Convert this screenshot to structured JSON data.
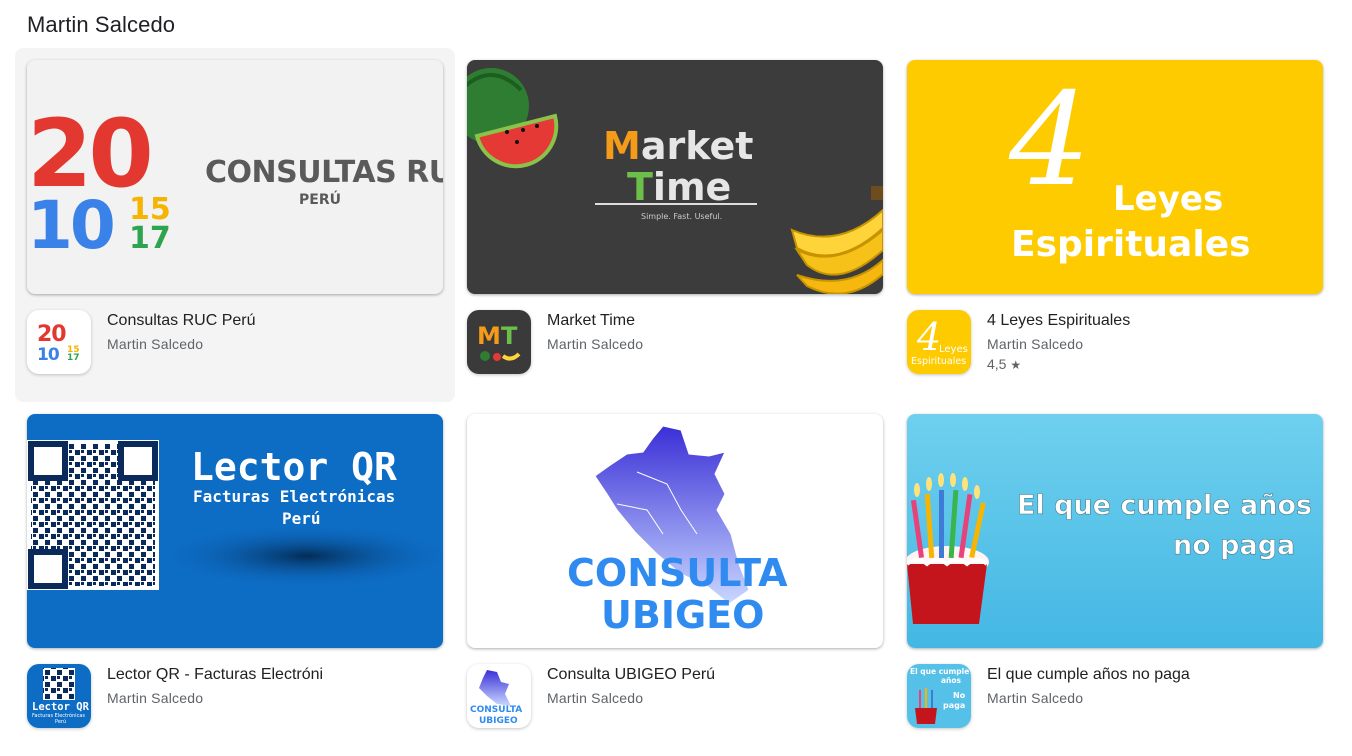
{
  "section": {
    "title": "Martin Salcedo"
  },
  "apps": [
    {
      "name": "Consultas RUC Perú",
      "developer": "Martin Salcedo",
      "banner": {
        "year_top": "20",
        "year_bottom": "10",
        "num_a": "15",
        "num_b": "17",
        "title": "CONSULTAS RUC",
        "subtitle": "PERÚ"
      },
      "icon": {
        "top": "20",
        "bottom": "10",
        "a": "15",
        "b": "17"
      }
    },
    {
      "name": "Market Time",
      "developer": "Martin Salcedo",
      "banner": {
        "line1_first": "M",
        "line1_rest": "arket",
        "line2_first": "T",
        "line2_rest": "ime",
        "tagline": "Simple. Fast. Useful."
      },
      "icon": {
        "m": "M",
        "t": "T"
      }
    },
    {
      "name": "4 Leyes Espirituales",
      "developer": "Martin Salcedo",
      "rating": "4,5",
      "rating_star": "★",
      "banner": {
        "numeral": "4",
        "word1": "Leyes",
        "word2": "Espirituales"
      },
      "icon": {
        "numeral": "4",
        "word1": "Leyes",
        "word2": "Espirituales"
      }
    },
    {
      "name": "Lector QR - Facturas Electróni",
      "developer": "Martin Salcedo",
      "banner": {
        "title": "Lector QR",
        "line2": "Facturas Electrónicas",
        "line3": "Perú"
      },
      "icon": {
        "title": "Lector QR",
        "sub": "Facturas Electrónicas",
        "sub2": "Perú"
      }
    },
    {
      "name": "Consulta UBIGEO Perú",
      "developer": "Martin Salcedo",
      "banner": {
        "line1": "CONSULTA",
        "line2": "UBIGEO"
      },
      "icon": {
        "line1": "CONSULTA",
        "line2": "UBIGEO"
      }
    },
    {
      "name": "El que cumple años no paga",
      "developer": "Martin Salcedo",
      "banner": {
        "line1": "El que cumple años",
        "line2": "no paga"
      },
      "icon": {
        "line1": "El que cumple",
        "line2": "años",
        "line3": "No",
        "line4": "paga"
      }
    }
  ]
}
